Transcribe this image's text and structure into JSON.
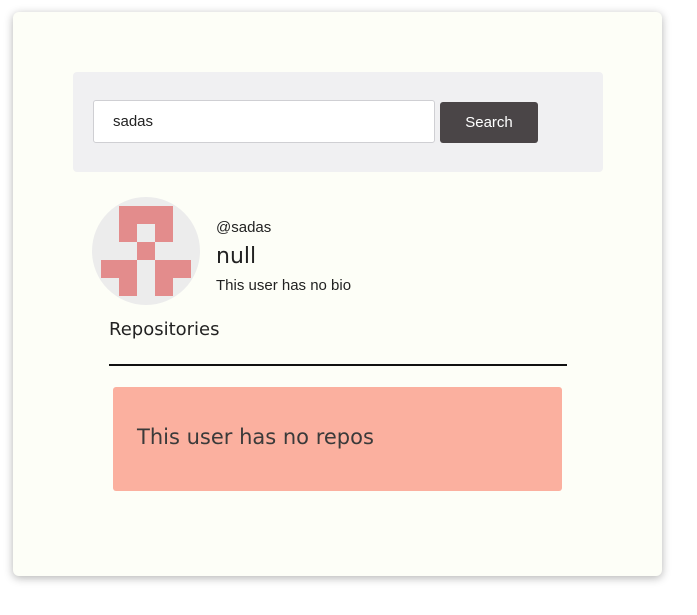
{
  "search": {
    "value": "sadas",
    "button_label": "Search"
  },
  "profile": {
    "avatar_icon": "identicon-avatar",
    "avatar_color": "#e38c8c",
    "handle": "@sadas",
    "name": "null",
    "bio": "This user has no bio"
  },
  "repositories": {
    "heading": "Repositories",
    "empty_message": "This user has no repos"
  },
  "colors": {
    "card_background": "#fdfef7",
    "search_panel_background": "#f0f0f2",
    "button_background": "#4a4547",
    "alert_background": "#fbb09f"
  }
}
